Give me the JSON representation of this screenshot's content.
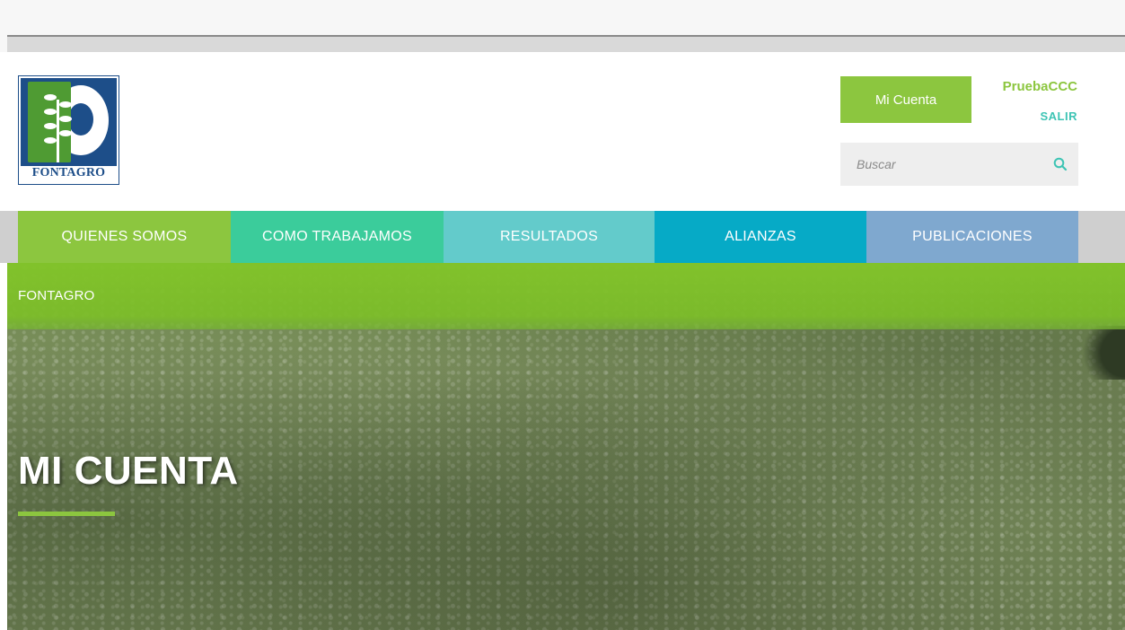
{
  "header": {
    "logo_text": "FONTAGRO",
    "account_button": "Mi Cuenta",
    "username": "PruebaCCC",
    "logout": "SALIR",
    "search": {
      "placeholder": "Buscar"
    }
  },
  "nav": {
    "items": [
      {
        "label": "QUIENES SOMOS",
        "color": "#8cc63f"
      },
      {
        "label": "COMO TRABAJAMOS",
        "color": "#3bcc9b"
      },
      {
        "label": "RESULTADOS",
        "color": "#63cbcb"
      },
      {
        "label": "ALIANZAS",
        "color": "#06aac6"
      },
      {
        "label": "PUBLICACIONES",
        "color": "#7fa8cf"
      }
    ]
  },
  "hero": {
    "breadcrumb": "FONTAGRO",
    "title": "MI CUENTA"
  },
  "colors": {
    "accent_green": "#8cc63f",
    "logout_teal": "#3dc4b4",
    "logo_blue": "#1d4e89"
  }
}
